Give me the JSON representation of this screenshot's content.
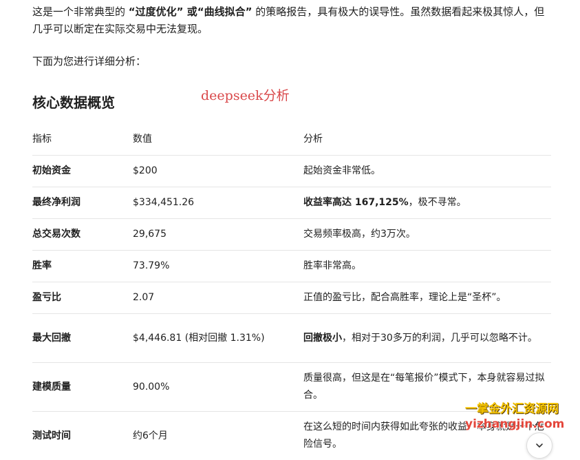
{
  "intro": {
    "p1_before": "这是一个非常典型的 ",
    "p1_bold_1": "“过度优化”",
    "p1_mid": " 或",
    "p1_bold_2": "“曲线拟合”",
    "p1_after": " 的策略报告，具有极大的误导性。虽然数据看起来极其惊人，但几乎可以断定在实际交易中无法复现。",
    "p2": "下面为您进行详细分析："
  },
  "section_title": "核心数据概览",
  "watermark_deepseek": "deepseek分析",
  "table": {
    "headers": [
      "指标",
      "数值",
      "分析"
    ],
    "rows": [
      {
        "metric": "初始资金",
        "value": "$200",
        "analysis_bold": "",
        "analysis": "起始资金非常低。"
      },
      {
        "metric": "最终净利润",
        "value": "$334,451.26",
        "analysis_bold": "收益率高达 167,125%",
        "analysis": "，极不寻常。"
      },
      {
        "metric": "总交易次数",
        "value": "29,675",
        "analysis_bold": "",
        "analysis": "交易频率极高，约3万次。"
      },
      {
        "metric": "胜率",
        "value": "73.79%",
        "analysis_bold": "",
        "analysis": "胜率非常高。"
      },
      {
        "metric": "盈亏比",
        "value": "2.07",
        "analysis_bold": "",
        "analysis": "正值的盈亏比，配合高胜率，理论上是“圣杯”。"
      },
      {
        "metric": "最大回撤",
        "value": "$4,446.81 (相对回撤 1.31%)",
        "analysis_bold": "回撤极小",
        "analysis": "，相对于30多万的利润，几乎可以忽略不计。"
      },
      {
        "metric": "建模质量",
        "value": "90.00%",
        "analysis_bold": "",
        "analysis": "质量很高，但这是在“每笔报价”模式下，本身就容易过拟合。"
      },
      {
        "metric": "测试时间",
        "value": "约6个月",
        "analysis_bold": "",
        "analysis": "在这么短的时间内获得如此夸张的收益，本身就是一个危险信号。"
      }
    ]
  },
  "watermark_brand": {
    "line1": "一掌金外汇资源网",
    "line2": "yizhangjin.com"
  },
  "icons": {
    "scroll_down": "chevron-down-icon"
  },
  "colors": {
    "watermark_red": "#d9484a",
    "brand_yellow": "#f5c400",
    "brand_red": "#e4473c",
    "divider": "#e5e5e5"
  }
}
